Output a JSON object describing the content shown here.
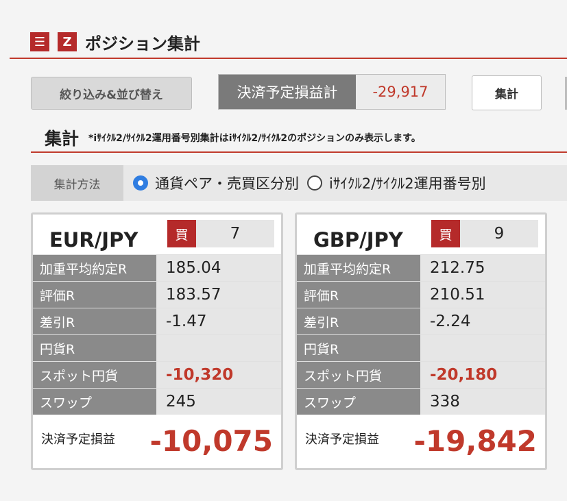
{
  "header": {
    "title": "ポジション集計",
    "menu_icon": "menu-icon",
    "brand_icon": "z-logo-icon"
  },
  "toolbar": {
    "filter_label": "絞り込み&並び替え",
    "pl_total_label": "決済予定損益計",
    "pl_total_value": "-29,917",
    "sum_button_label": "集計"
  },
  "section": {
    "title": "集計",
    "note": "*iｻｲｸﾙ2/ｻｲｸﾙ2運用番号別集計はiｻｲｸﾙ2/ｻｲｸﾙ2のポジションのみ表示します。"
  },
  "method": {
    "label": "集計方法",
    "options": [
      {
        "label": "通貨ペア・売買区分別",
        "selected": true
      },
      {
        "label": "iｻｲｸﾙ2/ｻｲｸﾙ2運用番号別",
        "selected": false
      }
    ]
  },
  "cards": [
    {
      "pair": "EUR/JPY",
      "side": "買",
      "count": "7",
      "rows": [
        {
          "label": "加重平均約定R",
          "value": "185.04"
        },
        {
          "label": "評価R",
          "value": "183.57"
        },
        {
          "label": "差引R",
          "value": "-1.47"
        },
        {
          "label": "円貨R",
          "value": ""
        },
        {
          "label": "スポット円貨",
          "value": "-10,320"
        },
        {
          "label": "スワップ",
          "value": "245"
        }
      ],
      "pl_label": "決済予定損益",
      "pl_value": "-10,075"
    },
    {
      "pair": "GBP/JPY",
      "side": "買",
      "count": "9",
      "rows": [
        {
          "label": "加重平均約定R",
          "value": "212.75"
        },
        {
          "label": "評価R",
          "value": "210.51"
        },
        {
          "label": "差引R",
          "value": "-2.24"
        },
        {
          "label": "円貨R",
          "value": ""
        },
        {
          "label": "スポット円貨",
          "value": "-20,180"
        },
        {
          "label": "スワップ",
          "value": "338"
        }
      ],
      "pl_label": "決済予定損益",
      "pl_value": "-19,842"
    }
  ],
  "colors": {
    "accent": "#c0392b",
    "brand": "#b52a2a",
    "radio_selected": "#2f7de1"
  }
}
